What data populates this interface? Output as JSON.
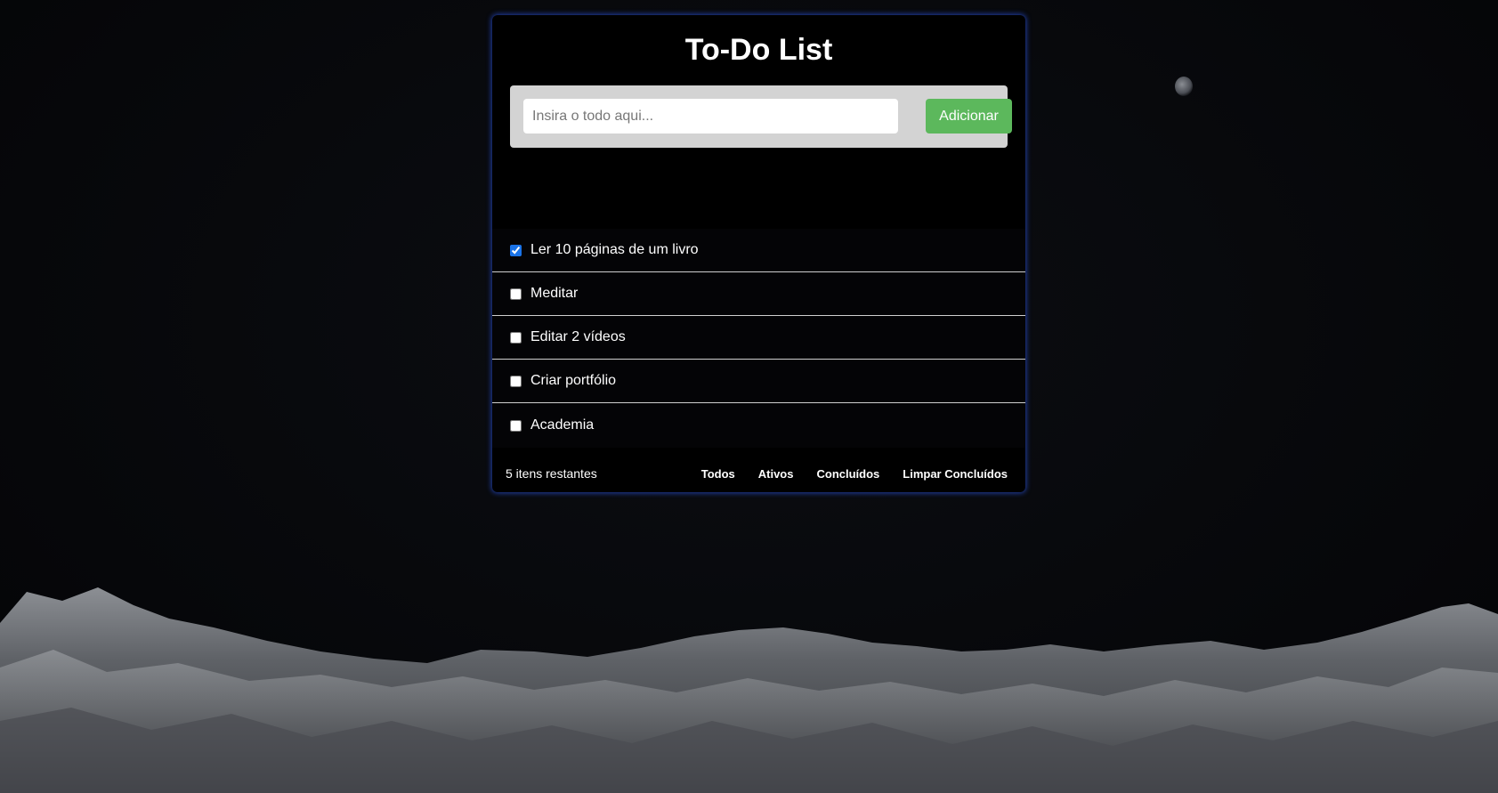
{
  "app": {
    "title": "To-Do List"
  },
  "add_form": {
    "input_value": "",
    "input_placeholder": "Insira o todo aqui...",
    "add_button_label": "Adicionar",
    "add_button_color": "#5cb85c"
  },
  "todos": [
    {
      "label": "Ler 10 páginas de um livro",
      "checked": true
    },
    {
      "label": "Meditar",
      "checked": false
    },
    {
      "label": "Editar 2 vídeos",
      "checked": false
    },
    {
      "label": "Criar portfólio",
      "checked": false
    },
    {
      "label": "Academia",
      "checked": false
    }
  ],
  "footer": {
    "remaining_text": "5 itens restantes",
    "filters": {
      "all": "Todos",
      "active": "Ativos",
      "completed": "Concluídos",
      "clear_completed": "Limpar Concluídos"
    }
  },
  "theme": {
    "card_glow": "#2850dc",
    "checkbox_accent": "#1a73e8"
  }
}
